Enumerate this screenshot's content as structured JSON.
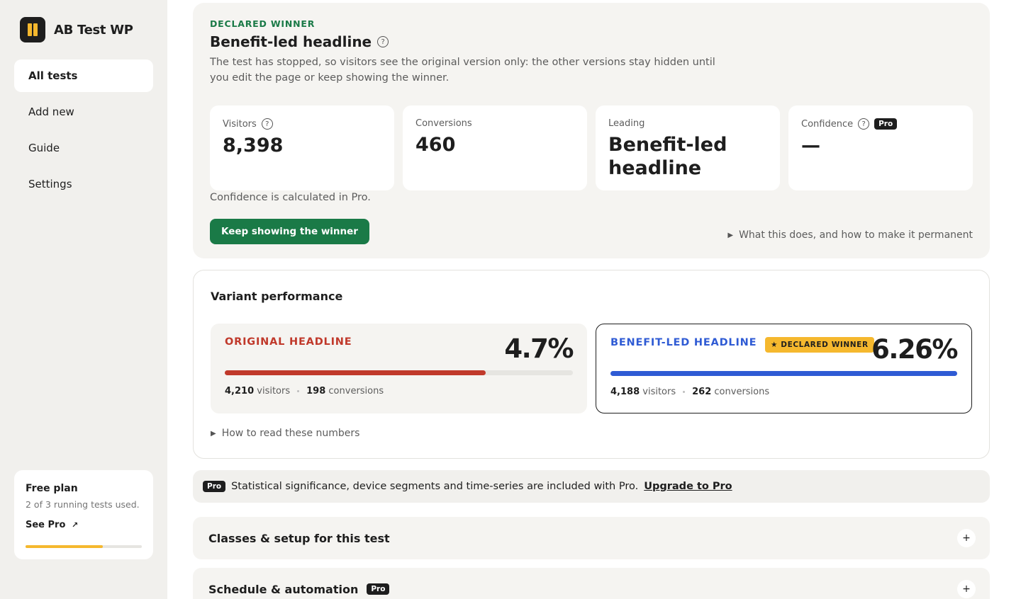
{
  "app": {
    "name": "AB Test WP"
  },
  "sidebar": {
    "items": [
      {
        "label": "All tests"
      },
      {
        "label": "Add new"
      },
      {
        "label": "Guide"
      },
      {
        "label": "Settings"
      }
    ],
    "plan": {
      "title": "Free plan",
      "usage": "2 of 3 running tests used.",
      "link": "See Pro",
      "used": 2,
      "limit": 3
    }
  },
  "winner": {
    "eyebrow": "DECLARED WINNER",
    "title": "Benefit-led headline",
    "description": "The test has stopped, so visitors see the original version only: the other versions stay hidden until you edit the page or keep showing the winner.",
    "stats": {
      "visitors_label": "Visitors",
      "visitors_value": "8,398",
      "conversions_label": "Conversions",
      "conversions_value": "460",
      "leading_label": "Leading",
      "leading_value": "Benefit-led headline",
      "confidence_label": "Confidence",
      "confidence_badge": "Pro",
      "confidence_value": "—"
    },
    "confidence_note": "Confidence is calculated in Pro.",
    "keep_button": "Keep showing the winner",
    "disclosure": "What this does, and how to make it permanent"
  },
  "performance": {
    "title": "Variant performance",
    "variants": [
      {
        "name": "ORIGINAL HEADLINE",
        "rate": "4.7%",
        "visitors": "4,210",
        "visitors_label": "visitors",
        "conversions": "198",
        "conversions_label": "conversions",
        "bar_fraction": 0.75
      },
      {
        "name": "BENEFIT-LED HEADLINE",
        "badge": "★ DECLARED WINNER",
        "rate": "6.26%",
        "visitors": "4,188",
        "visitors_label": "visitors",
        "conversions": "262",
        "conversions_label": "conversions",
        "bar_fraction": 1.0
      }
    ],
    "disclosure": "How to read these numbers"
  },
  "pro_banner": {
    "badge": "Pro",
    "text": "Statistical significance, device segments and time-series are included with Pro.",
    "link": "Upgrade to Pro"
  },
  "sections": [
    {
      "title": "Classes & setup for this test",
      "toggle": "+"
    },
    {
      "title": "Schedule & automation",
      "badge": "Pro",
      "toggle": "+"
    }
  ],
  "colors": {
    "accent_green": "#1a7a47",
    "original_red": "#c0392b",
    "winner_blue": "#2f5bd4",
    "badge_yellow": "#f5b82e"
  }
}
